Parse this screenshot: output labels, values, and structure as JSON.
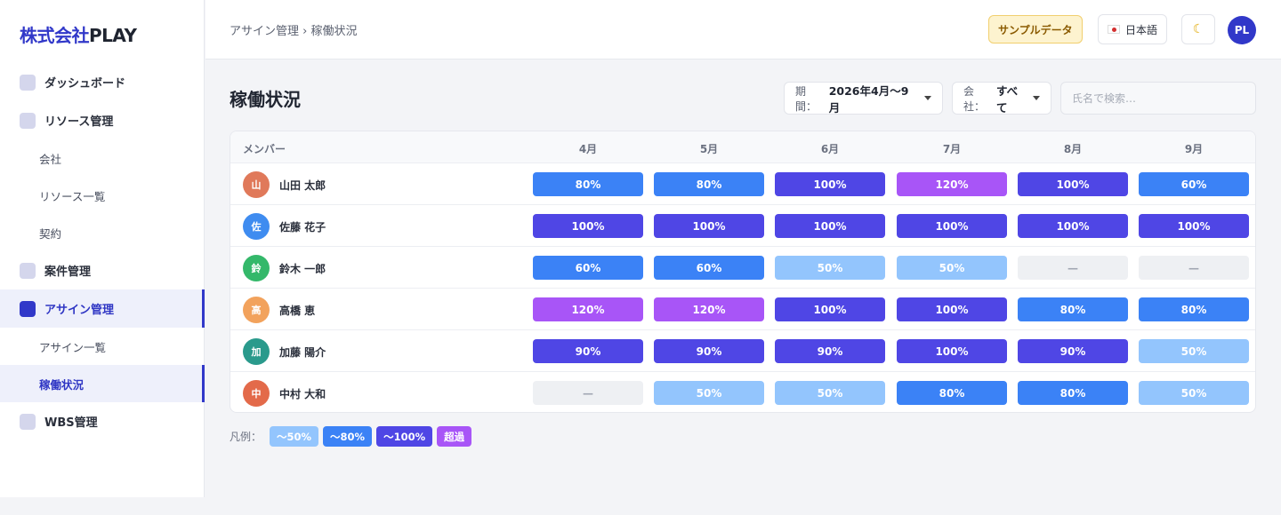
{
  "brand": {
    "part1": "株式会社",
    "part2": "PLAY"
  },
  "sidebar": {
    "items": [
      {
        "label": "ダッシュボード",
        "level": 1
      },
      {
        "label": "リソース管理",
        "level": 1
      },
      {
        "label": "会社",
        "level": 2
      },
      {
        "label": "リソース一覧",
        "level": 2
      },
      {
        "label": "契約",
        "level": 2
      },
      {
        "label": "案件管理",
        "level": 1
      },
      {
        "label": "アサイン管理",
        "level": 1,
        "active": true
      },
      {
        "label": "アサイン一覧",
        "level": 2
      },
      {
        "label": "稼働状況",
        "level": 2,
        "active": true
      },
      {
        "label": "WBS管理",
        "level": 1
      }
    ]
  },
  "header": {
    "breadcrumb": "アサイン管理 › 稼働状況",
    "sample_badge": "サンプルデータ",
    "language": "日本語",
    "user_initials": "PL"
  },
  "page": {
    "title": "稼働状況",
    "period_label": "期間：",
    "period_value": "2026年4月〜9月",
    "company_label": "会社：",
    "company_value": "すべて",
    "search_placeholder": "氏名で検索…"
  },
  "table": {
    "member_header": "メンバー",
    "months": [
      "4月",
      "5月",
      "6月",
      "7月",
      "8月",
      "9月"
    ],
    "rows": [
      {
        "initial": "山",
        "name": "山田 太郎",
        "avatar_color": "#e0795a",
        "values": [
          "80%",
          "80%",
          "100%",
          "120%",
          "100%",
          "60%"
        ]
      },
      {
        "initial": "佐",
        "name": "佐藤 花子",
        "avatar_color": "#3f8cf0",
        "values": [
          "100%",
          "100%",
          "100%",
          "100%",
          "100%",
          "100%"
        ]
      },
      {
        "initial": "鈴",
        "name": "鈴木 一郎",
        "avatar_color": "#34b86a",
        "values": [
          "60%",
          "60%",
          "50%",
          "50%",
          "—",
          "—"
        ]
      },
      {
        "initial": "高",
        "name": "高橋 恵",
        "avatar_color": "#f2a25c",
        "values": [
          "120%",
          "120%",
          "100%",
          "100%",
          "80%",
          "80%"
        ]
      },
      {
        "initial": "加",
        "name": "加藤 陽介",
        "avatar_color": "#2a9a8c",
        "values": [
          "90%",
          "90%",
          "90%",
          "100%",
          "90%",
          "50%"
        ]
      },
      {
        "initial": "中",
        "name": "中村 大和",
        "avatar_color": "#e36a4a",
        "values": [
          "—",
          "50%",
          "50%",
          "80%",
          "80%",
          "50%"
        ]
      }
    ]
  },
  "legend": {
    "label": "凡例：",
    "items": [
      {
        "label": "〜50%",
        "color": "#93c5fd"
      },
      {
        "label": "〜80%",
        "color": "#3b82f6"
      },
      {
        "label": "〜100%",
        "color": "#4f46e5"
      },
      {
        "label": "超過",
        "color": "#a855f7"
      }
    ]
  },
  "colors": {
    "accent": "#3138c9",
    "empty_cell": "#eef0f3",
    "empty_text": "#a0a6b2"
  }
}
